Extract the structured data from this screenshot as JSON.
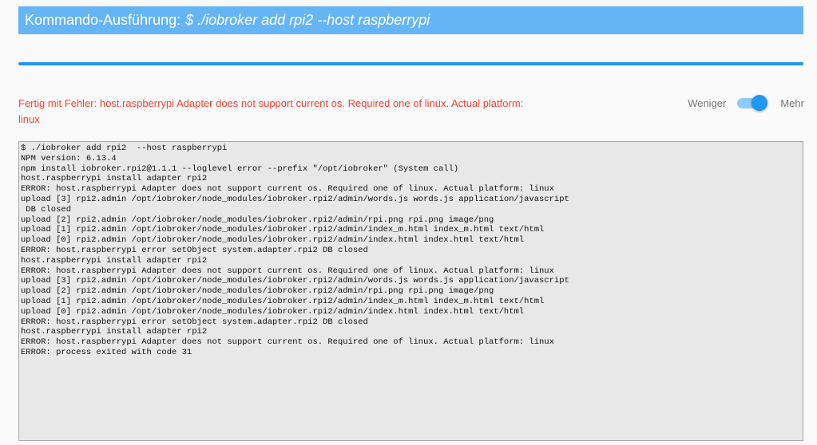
{
  "header": {
    "title_prefix": "Kommando-Ausführung:",
    "command": "$ ./iobroker add rpi2 --host raspberrypi"
  },
  "progress": {
    "percent": 100
  },
  "status": {
    "message": "Fertig mit Fehler: host.raspberrypi Adapter does not support current os. Required one of linux. Actual platform: linux"
  },
  "toggle": {
    "less_label": "Weniger",
    "more_label": "Mehr",
    "state": "on"
  },
  "log": {
    "text": "$ ./iobroker add rpi2  --host raspberrypi\nNPM version: 6.13.4\nnpm install iobroker.rpi2@1.1.1 --loglevel error --prefix \"/opt/iobroker\" (System call)\nhost.raspberrypi install adapter rpi2\nERROR: host.raspberrypi Adapter does not support current os. Required one of linux. Actual platform: linux\nupload [3] rpi2.admin /opt/iobroker/node_modules/iobroker.rpi2/admin/words.js words.js application/javascript\n DB closed\nupload [2] rpi2.admin /opt/iobroker/node_modules/iobroker.rpi2/admin/rpi.png rpi.png image/png\nupload [1] rpi2.admin /opt/iobroker/node_modules/iobroker.rpi2/admin/index_m.html index_m.html text/html\nupload [0] rpi2.admin /opt/iobroker/node_modules/iobroker.rpi2/admin/index.html index.html text/html\nERROR: host.raspberrypi error setObject system.adapter.rpi2 DB closed\nhost.raspberrypi install adapter rpi2\nERROR: host.raspberrypi Adapter does not support current os. Required one of linux. Actual platform: linux\nupload [3] rpi2.admin /opt/iobroker/node_modules/iobroker.rpi2/admin/words.js words.js application/javascript\nupload [2] rpi2.admin /opt/iobroker/node_modules/iobroker.rpi2/admin/rpi.png rpi.png image/png\nupload [1] rpi2.admin /opt/iobroker/node_modules/iobroker.rpi2/admin/index_m.html index_m.html text/html\nupload [0] rpi2.admin /opt/iobroker/node_modules/iobroker.rpi2/admin/index.html index.html text/html\nERROR: host.raspberrypi error setObject system.adapter.rpi2 DB closed\nhost.raspberrypi install adapter rpi2\nERROR: host.raspberrypi Adapter does not support current os. Required one of linux. Actual platform: linux\nERROR: process exited with code 31"
  },
  "colors": {
    "header_bg": "#64b5f6",
    "accent": "#2196f3",
    "error": "#f44336",
    "log_bg": "#e8e8e8"
  }
}
